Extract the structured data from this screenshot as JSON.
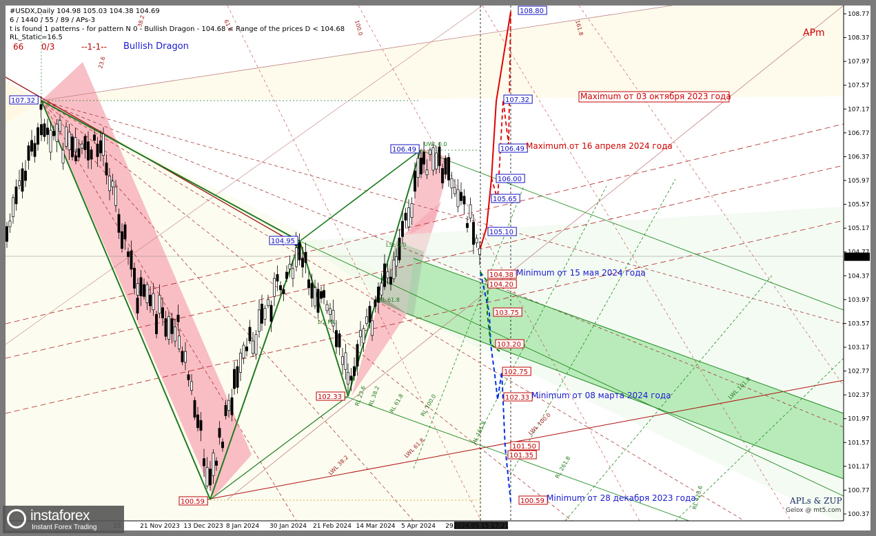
{
  "header": {
    "symbol_line": "#USDX,Daily  104.98 105.03 104.38 104.69",
    "line2": "6 / 1440 / 55 / 89 / APs-3",
    "line3": "t is found 1 patterns  -  for pattern N 0 - Bullish Dragon - 104.68 < Range of the prices D < 104.68",
    "line4": "RL_Static=16.5",
    "num_left": "66",
    "num_right": "0/3",
    "dash_text": "--1-1--",
    "pattern_name": "Bullish Dragon",
    "apm": "APm"
  },
  "colors": {
    "background": "#ffffff",
    "frame": "#7a7a7a",
    "candle": "#000000",
    "green_line": "#1c8a1c",
    "pink_zone": "#f6a9b4",
    "green_zone": "#7dd97d",
    "red_dash": "#e00000",
    "blue_dash": "#0030e0"
  },
  "chart_data": {
    "type": "candlestick",
    "y_ticks": [
      "108.77",
      "108.37",
      "107.97",
      "107.57",
      "107.17",
      "106.77",
      "106.37",
      "105.97",
      "105.57",
      "105.17",
      "104.77",
      "104.37",
      "103.97",
      "103.57",
      "103.17",
      "102.77",
      "102.37",
      "101.97",
      "101.57",
      "101.17",
      "100.77",
      "100.37"
    ],
    "ylim": [
      100.3,
      108.9
    ],
    "x_ticks": [
      "23",
      "21 Nov 2023",
      "13 Dec 2023",
      "8 Jan 2024",
      "30 Jan 2024",
      "21 Feb 2024",
      "14 Mar 2024",
      "5 Apr 2024",
      "29"
    ],
    "current_date": "2024.05.15 17:21",
    "current_price": "104.69",
    "ohlc_last": {
      "open": 104.98,
      "high": 105.03,
      "low": 104.38,
      "close": 104.69
    },
    "pattern_points": [
      {
        "label": "107.32",
        "value": 107.32
      },
      {
        "label": "100.59",
        "value": 100.59
      },
      {
        "label": "104.95",
        "value": 104.95
      },
      {
        "label": "102.33",
        "value": 102.33
      },
      {
        "label": "106.49",
        "value": 106.49
      }
    ],
    "targets_up": [
      "108.80",
      "107.32",
      "106.49",
      "106.00",
      "105.65",
      "105.10"
    ],
    "targets_down": [
      "104.38",
      "104.20",
      "103.75",
      "103.20",
      "102.75",
      "102.33",
      "101.50",
      "101.35",
      "100.59"
    ],
    "annotations": [
      "Maximum от 03 октября 2023 года",
      "Maximum от 16 апреля 2024 года",
      "Minimum от 15 мая 2024 года",
      "Minimum от 08 марта 2024 года",
      "Minimum от 28 декабря 2023 года"
    ],
    "fan_labels": [
      "61.8",
      "100.0",
      "161.8",
      "23.6",
      "38.2",
      "1/2 ML",
      "UWL 0.0",
      "LSL 0.0",
      "SL 61.8",
      "RL 23.6",
      "RL 38.2",
      "RL 61.8",
      "RL 100.0",
      "RL 161.8",
      "LWL 38.2",
      "LWL 61.8",
      "LWL 100.0",
      "RL 261.8",
      "RL 423.6",
      "LWL 161.8"
    ]
  },
  "credits": {
    "line1": "APLs & ZUP",
    "line2": "Gelox @ mt5.com"
  },
  "logo": {
    "name": "instaforex",
    "tagline": "Instant Forex Trading"
  }
}
